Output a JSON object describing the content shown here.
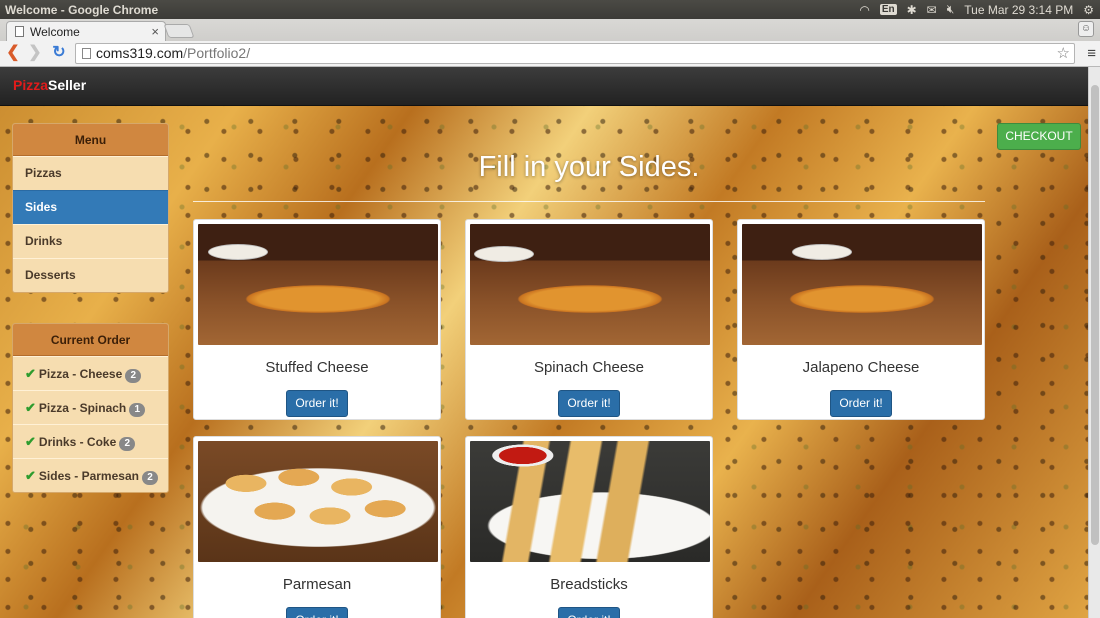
{
  "os": {
    "window_title": "Welcome - Google Chrome",
    "input_lang": "En",
    "clock": "Tue Mar 29  3:14 PM"
  },
  "browser": {
    "tab_title": "Welcome",
    "url_host": "coms319.com",
    "url_path": "/Portfolio2/"
  },
  "app": {
    "brand_part1": "Pizza",
    "brand_part2": "Seller",
    "checkout_label": "CHECKOUT",
    "heading": "Fill in your Sides."
  },
  "menu": {
    "title": "Menu",
    "items": [
      {
        "label": "Pizzas"
      },
      {
        "label": "Sides"
      },
      {
        "label": "Drinks"
      },
      {
        "label": "Desserts"
      }
    ],
    "active": "Sides"
  },
  "current_order": {
    "title": "Current Order",
    "items": [
      {
        "label": "Pizza - Cheese",
        "count": "2"
      },
      {
        "label": "Pizza - Spinach",
        "count": "1"
      },
      {
        "label": "Drinks - Coke",
        "count": "2"
      },
      {
        "label": "Sides - Parmesan",
        "count": "2"
      }
    ]
  },
  "products": [
    {
      "name": "Stuffed Cheese",
      "button": "Order it!"
    },
    {
      "name": "Spinach Cheese",
      "button": "Order it!"
    },
    {
      "name": "Jalapeno Cheese",
      "button": "Order it!"
    },
    {
      "name": "Parmesan",
      "button": "Order it!"
    },
    {
      "name": "Breadsticks",
      "button": "Order it!"
    }
  ],
  "colors": {
    "brand_red": "#e21b1b",
    "active_blue": "#337ab7",
    "checkout_green": "#4cae4c",
    "panel_head": "#d08740"
  }
}
